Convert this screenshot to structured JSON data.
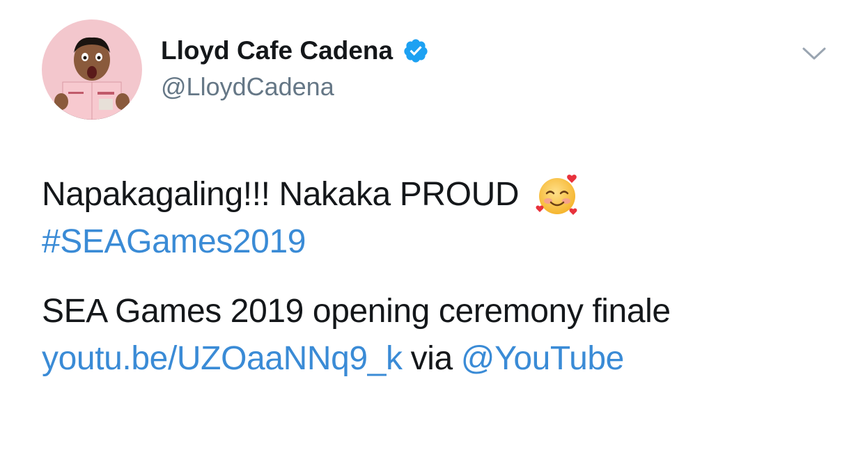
{
  "author": {
    "display_name": "Lloyd Cafe Cadena",
    "handle": "@LloydCadena",
    "verified": true,
    "avatar_icon": "avatar-photo",
    "verified_icon": "verified-badge-icon"
  },
  "menu": {
    "icon": "chevron-down-icon"
  },
  "tweet": {
    "line1_text": "Napakagaling!!! Nakaka PROUD",
    "line1_emoji": "smiling-face-with-hearts-icon",
    "hashtag": "#SEAGames2019",
    "line3_text": "SEA Games 2019 opening ceremony finale",
    "link_url": "youtu.be/UZOaaNNq9_k",
    "via_text": "via",
    "mention": "@YouTube"
  },
  "colors": {
    "link": "#3a8bd6",
    "text": "#14171a",
    "handle": "#657786",
    "verified": "#1da1f2"
  }
}
